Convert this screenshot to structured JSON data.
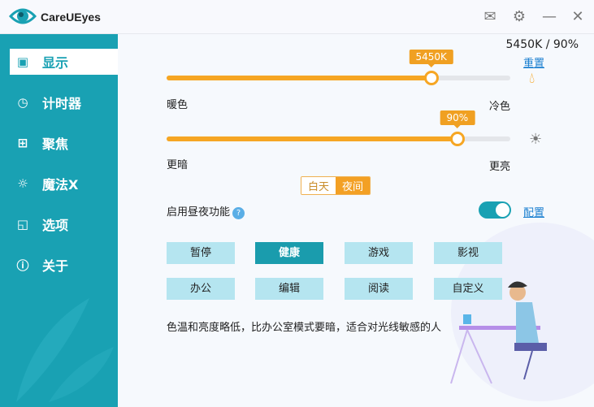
{
  "app": {
    "title": "CareUEyes"
  },
  "titlebar": {
    "icons": [
      "mail-icon",
      "gear-icon",
      "minimize-icon",
      "close-icon"
    ]
  },
  "sidebar": {
    "items": [
      {
        "label": "显示",
        "icon": "monitor-icon",
        "active": true
      },
      {
        "label": "计时器",
        "icon": "clock-icon"
      },
      {
        "label": "聚焦",
        "icon": "windows-icon"
      },
      {
        "label": "魔法X",
        "icon": "sun-icon"
      },
      {
        "label": "选项",
        "icon": "options-icon"
      },
      {
        "label": "关于",
        "icon": "info-icon"
      }
    ]
  },
  "display": {
    "readout": "5450K / 90%",
    "reset": "重置",
    "temperature": {
      "tooltip": "5450K",
      "value": 5450,
      "fraction": 0.77,
      "left": "暖色",
      "right": "冷色"
    },
    "brightness": {
      "tooltip": "90%",
      "value": 90,
      "fraction": 0.846,
      "left": "更暗",
      "right": "更亮"
    },
    "daynight": {
      "day": "白天",
      "night": "夜间",
      "selected": "夜间"
    },
    "enable_label": "启用昼夜功能",
    "help": "?",
    "enabled": true,
    "config": "配置",
    "modes": [
      "暂停",
      "健康",
      "游戏",
      "影视",
      "办公",
      "编辑",
      "阅读",
      "自定义"
    ],
    "selected_mode": "健康",
    "description": "色温和亮度略低，比办公室模式要暗，适合对光线敏感的人"
  },
  "colors": {
    "accent": "#19a1b3",
    "orange": "#f6a623",
    "mode_bg": "#b5e5f0"
  }
}
